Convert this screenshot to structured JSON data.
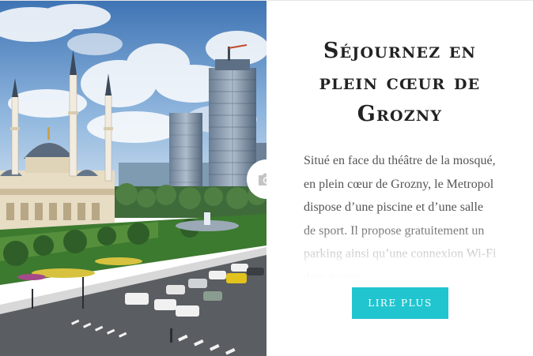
{
  "hotel_card": {
    "title": "Séjournez en plein cœur de Grozny",
    "description": "Situé en face du théâtre de la mosqué, en plein cœur de Grozny, le Metropol dispose d’une piscine et d’une salle de sport. Il propose gratuitement un parking ainsi qu’une connexion Wi-Fi dans toutes",
    "read_more_label": "LIRE PLUS",
    "image_icon": "camera-icon",
    "image_alt": "Grozny"
  },
  "colors": {
    "accent": "#21c5cf",
    "title": "#222222",
    "body_text": "#555555",
    "background": "#ffffff"
  }
}
